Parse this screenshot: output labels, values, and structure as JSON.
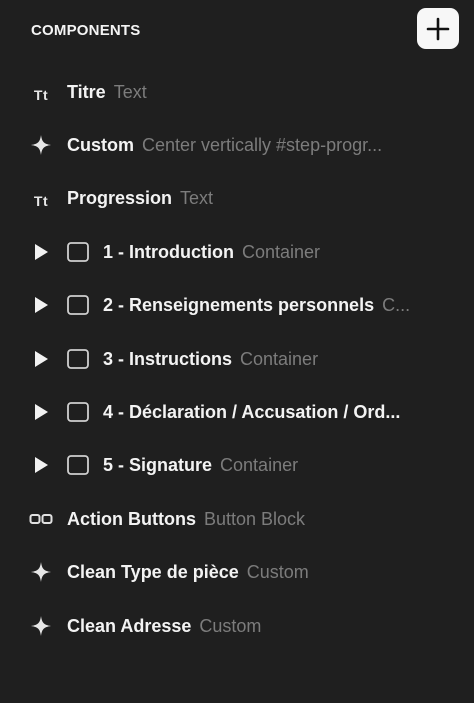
{
  "header": {
    "title": "COMPONENTS",
    "add_icon": "plus-icon"
  },
  "items": [
    {
      "icon": "text-icon",
      "icon_text": "Tt",
      "name": "Titre",
      "type": "Text",
      "expandable": false
    },
    {
      "icon": "sparkle-icon",
      "name": "Custom",
      "type": "Center vertically #step-progr...",
      "expandable": false
    },
    {
      "icon": "text-icon",
      "icon_text": "Tt",
      "name": "Progression",
      "type": "Text",
      "expandable": false
    },
    {
      "icon": "container-icon",
      "name": "1 - Introduction",
      "type": "Container",
      "expandable": true
    },
    {
      "icon": "container-icon",
      "name": "2 - Renseignements personnels",
      "type": "C...",
      "expandable": true
    },
    {
      "icon": "container-icon",
      "name": "3 - Instructions",
      "type": "Container",
      "expandable": true
    },
    {
      "icon": "container-icon",
      "name": "4 - Déclaration / Accusation / Ord...",
      "type": "",
      "expandable": true
    },
    {
      "icon": "container-icon",
      "name": "5 - Signature",
      "type": "Container",
      "expandable": true
    },
    {
      "icon": "button-block-icon",
      "name": "Action Buttons",
      "type": "Button Block",
      "expandable": false
    },
    {
      "icon": "sparkle-icon",
      "name": "Clean Type de pièce",
      "type": "Custom",
      "expandable": false
    },
    {
      "icon": "sparkle-icon",
      "name": "Clean Adresse",
      "type": "Custom",
      "expandable": false
    }
  ]
}
